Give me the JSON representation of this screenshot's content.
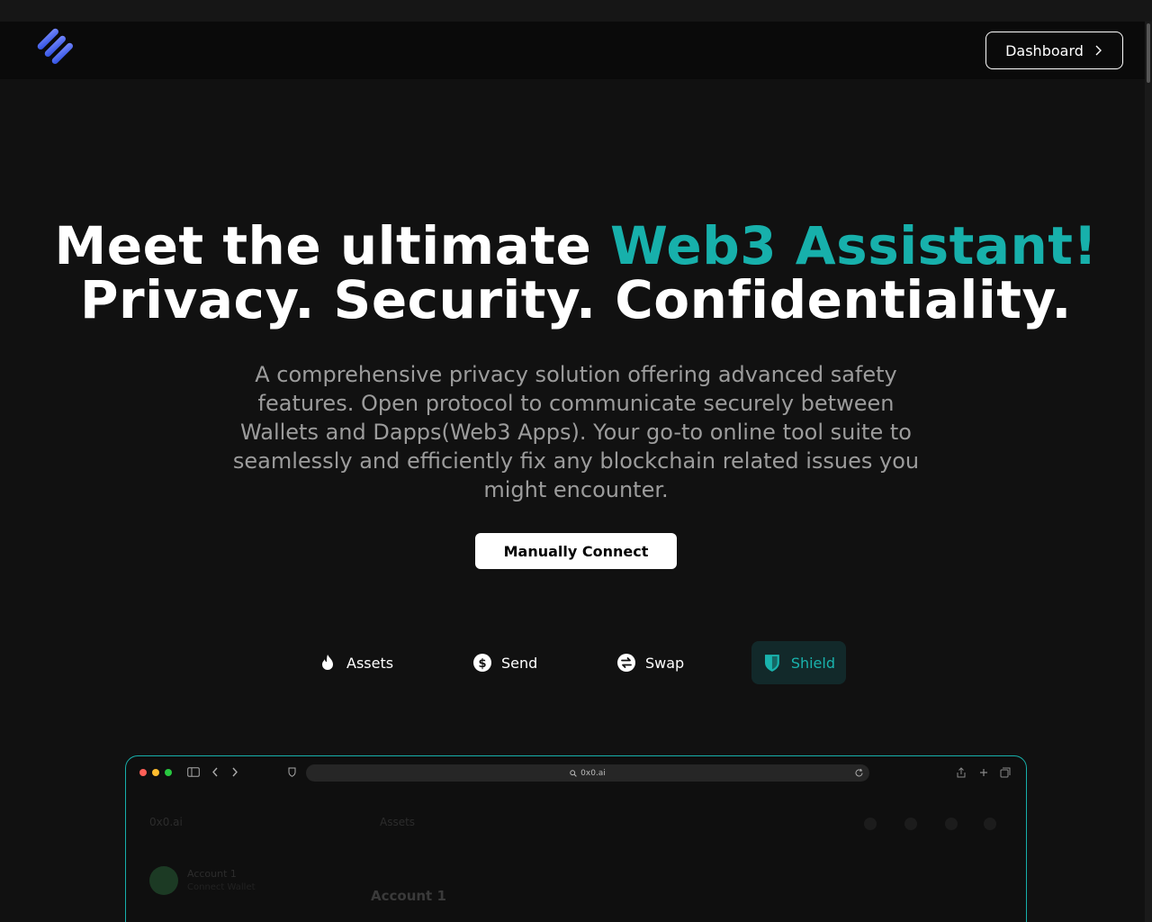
{
  "header": {
    "logo_icon": "stacked-stripes-logo",
    "dashboard_label": "Dashboard"
  },
  "hero": {
    "title_part1": "Meet the ultimate ",
    "title_accent": "Web3 Assistant!",
    "title_line2": "Privacy. Security. Confidentiality.",
    "subtitle": "A comprehensive privacy solution offering advanced safety features. Open protocol to communicate securely between Wallets and Dapps(Web3 Apps). Your go-to online tool suite to seamlessly and efficiently fix any blockchain related issues you might encounter.",
    "cta_label": "Manually Connect"
  },
  "colors": {
    "accent": "#17b0ab",
    "background": "#111111",
    "navbar": "#0a0a0a"
  },
  "tabs": [
    {
      "label": "Assets",
      "icon": "flame-icon",
      "active": false
    },
    {
      "label": "Send",
      "icon": "dollar-circle-icon",
      "active": false
    },
    {
      "label": "Swap",
      "icon": "swap-circle-icon",
      "active": false
    },
    {
      "label": "Shield",
      "icon": "shield-icon",
      "active": true
    }
  ],
  "preview": {
    "url": "0x0.ai",
    "sidebar_title": "0x0.ai",
    "section_title": "Assets",
    "account_name": "Account 1",
    "account_sub": "Connect Wallet",
    "main_account_title": "Account 1"
  }
}
